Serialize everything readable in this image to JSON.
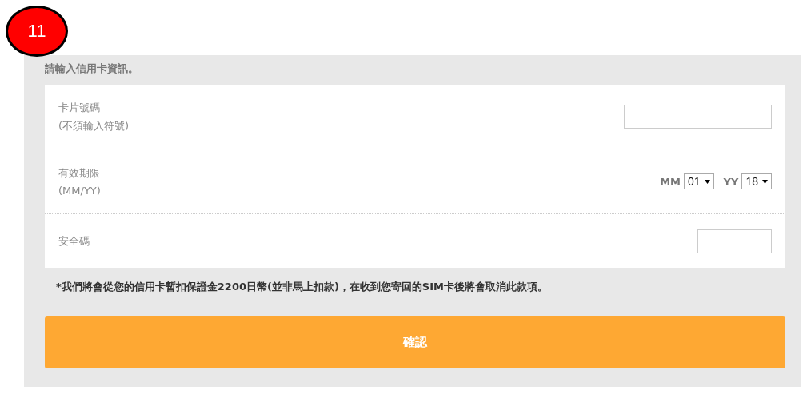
{
  "step_badge": "11",
  "heading": "請輸入信用卡資訊。",
  "fields": [
    {
      "kind": "text",
      "label": "卡片號碼",
      "hint": "(不須輸入符號)"
    },
    {
      "kind": "expiry",
      "label": "有效期限",
      "hint": "(MM/YY)",
      "selects": [
        {
          "label": "MM",
          "value": "01"
        },
        {
          "label": "YY",
          "value": "18"
        }
      ]
    },
    {
      "kind": "short",
      "label": "安全碼"
    }
  ],
  "note": "*我們將會從您的信用卡暫扣保證金2200日幣(並非馬上扣款)，在收到您寄回的SIM卡後將會取消此款項。",
  "confirm_button": "確認"
}
